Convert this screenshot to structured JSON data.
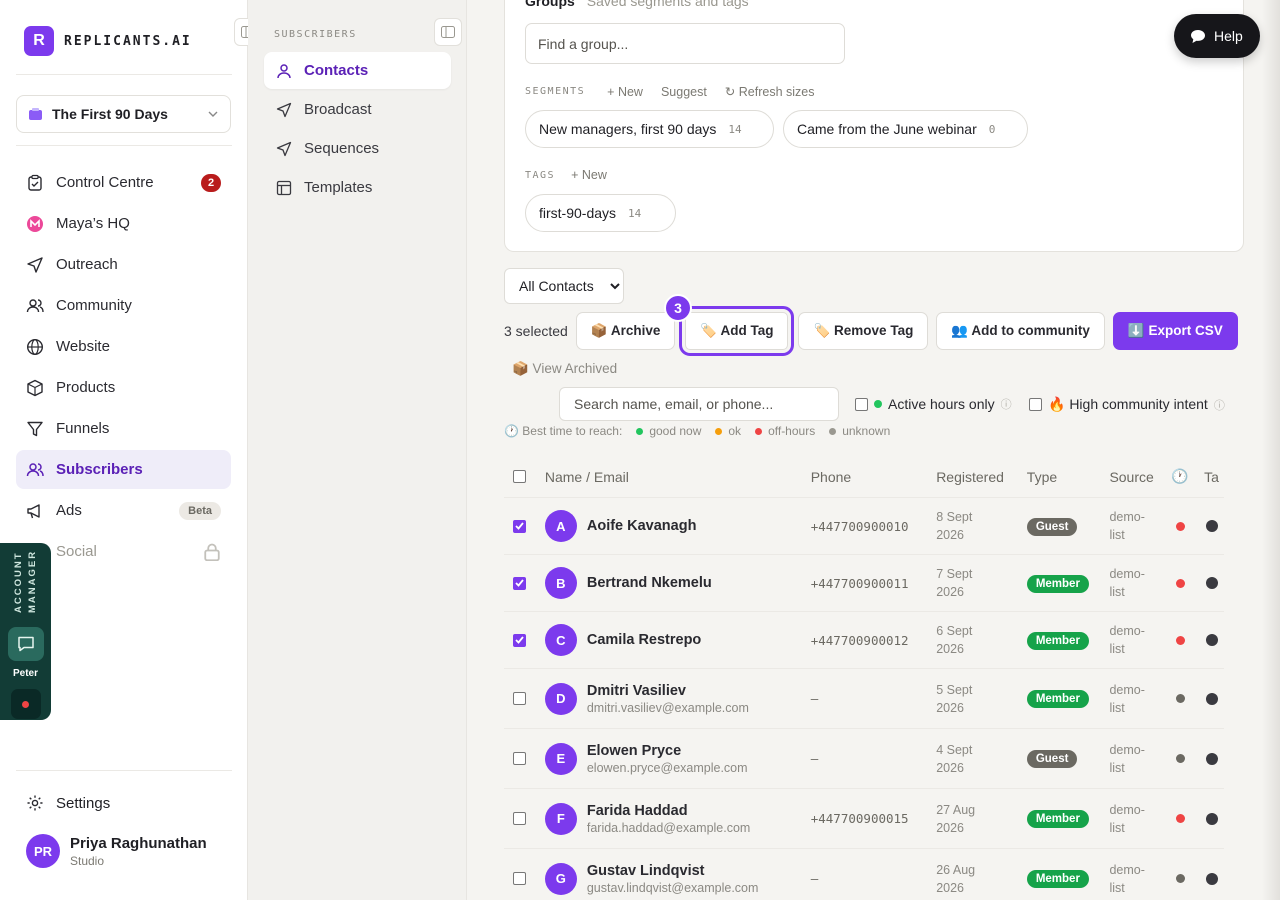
{
  "brand": {
    "mark": "R",
    "name": "REPLICANTS.AI"
  },
  "workspace": {
    "name": "The First 90 Days"
  },
  "nav": [
    {
      "label": "Control Centre",
      "badge": "2"
    },
    {
      "label": "Maya’s HQ"
    },
    {
      "label": "Outreach"
    },
    {
      "label": "Community"
    },
    {
      "label": "Website"
    },
    {
      "label": "Products"
    },
    {
      "label": "Funnels"
    },
    {
      "label": "Subscribers",
      "active": true
    },
    {
      "label": "Ads",
      "badge": "Beta"
    },
    {
      "label": "Social",
      "locked": true
    }
  ],
  "settings_label": "Settings",
  "user": {
    "initials": "PR",
    "name": "Priya Raghunathan",
    "org": "Studio"
  },
  "account_manager": {
    "label": "ACCOUNT MANAGER",
    "name": "Peter"
  },
  "subnav": {
    "title": "SUBSCRIBERS",
    "items": [
      "Contacts",
      "Broadcast",
      "Sequences",
      "Templates"
    ]
  },
  "groups": {
    "heading": "Groups",
    "subheading": "Saved segments and tags",
    "search_placeholder": "Find a group...",
    "segments_label": "SEGMENTS",
    "segments_actions": [
      "+ New",
      "Suggest",
      "↻ Refresh sizes"
    ],
    "segments": [
      {
        "name": "New managers, first 90 days",
        "count": "14"
      },
      {
        "name": "Came from the June webinar",
        "count": "0"
      }
    ],
    "tags_label": "TAGS",
    "tags_actions": [
      "+ New"
    ],
    "tags": [
      {
        "name": "first-90-days",
        "count": "14"
      }
    ]
  },
  "filter": {
    "selected": "All Contacts"
  },
  "actions": {
    "selected_text": "3 selected",
    "archive": "📦 Archive",
    "add_tag": "🏷️ Add Tag",
    "remove_tag": "🏷️ Remove Tag",
    "add_community": "👥 Add to community",
    "export": "⬇️ Export CSV",
    "step_badge": "3"
  },
  "view_archived": "📦 View Archived",
  "search": {
    "placeholder": "Search name, email, or phone..."
  },
  "options": {
    "active_hours": "Active hours only",
    "high_intent": "🔥 High community intent"
  },
  "legend": {
    "label": "🕐 Best time to reach:",
    "items": [
      {
        "label": "good now",
        "color": "#22c55e"
      },
      {
        "label": "ok",
        "color": "#f59e0b"
      },
      {
        "label": "off-hours",
        "color": "#ef4444"
      },
      {
        "label": "unknown",
        "color": "#9a9890"
      }
    ]
  },
  "table": {
    "headers": {
      "name": "Name / Email",
      "phone": "Phone",
      "registered": "Registered",
      "type": "Type",
      "source": "Source",
      "clock": "🕐",
      "tags": "Ta"
    },
    "rows": [
      {
        "initial": "A",
        "name": "Aoife Kavanagh",
        "email": "",
        "phone": "+447700900010",
        "reg1": "8 Sept",
        "reg2": "2026",
        "type": "Guest",
        "src1": "demo-",
        "src2": "list",
        "checked": true,
        "status": "off"
      },
      {
        "initial": "B",
        "name": "Bertrand Nkemelu",
        "email": "",
        "phone": "+447700900011",
        "reg1": "7 Sept",
        "reg2": "2026",
        "type": "Member",
        "src1": "demo-",
        "src2": "list",
        "checked": true,
        "status": "off"
      },
      {
        "initial": "C",
        "name": "Camila Restrepo",
        "email": "",
        "phone": "+447700900012",
        "reg1": "6 Sept",
        "reg2": "2026",
        "type": "Member",
        "src1": "demo-",
        "src2": "list",
        "checked": true,
        "status": "off"
      },
      {
        "initial": "D",
        "name": "Dmitri Vasiliev",
        "email": "dmitri.vasiliev@example.com",
        "phone": "–",
        "reg1": "5 Sept",
        "reg2": "2026",
        "type": "Member",
        "src1": "demo-",
        "src2": "list",
        "checked": false,
        "status": "unknown"
      },
      {
        "initial": "E",
        "name": "Elowen Pryce",
        "email": "elowen.pryce@example.com",
        "phone": "–",
        "reg1": "4 Sept",
        "reg2": "2026",
        "type": "Guest",
        "src1": "demo-",
        "src2": "list",
        "checked": false,
        "status": "unknown"
      },
      {
        "initial": "F",
        "name": "Farida Haddad",
        "email": "farida.haddad@example.com",
        "phone": "+447700900015",
        "reg1": "27 Aug",
        "reg2": "2026",
        "type": "Member",
        "src1": "demo-",
        "src2": "list",
        "checked": false,
        "status": "off"
      },
      {
        "initial": "G",
        "name": "Gustav Lindqvist",
        "email": "gustav.lindqvist@example.com",
        "phone": "–",
        "reg1": "26 Aug",
        "reg2": "2026",
        "type": "Member",
        "src1": "demo-",
        "src2": "list",
        "checked": false,
        "status": "unknown"
      }
    ]
  },
  "help": {
    "label": "Help"
  },
  "colors": {
    "accent": "#7c3aed",
    "off_hours": "#ef4444",
    "unknown": "#6b6962",
    "member": "#16a34a",
    "guest": "#6b6962"
  }
}
